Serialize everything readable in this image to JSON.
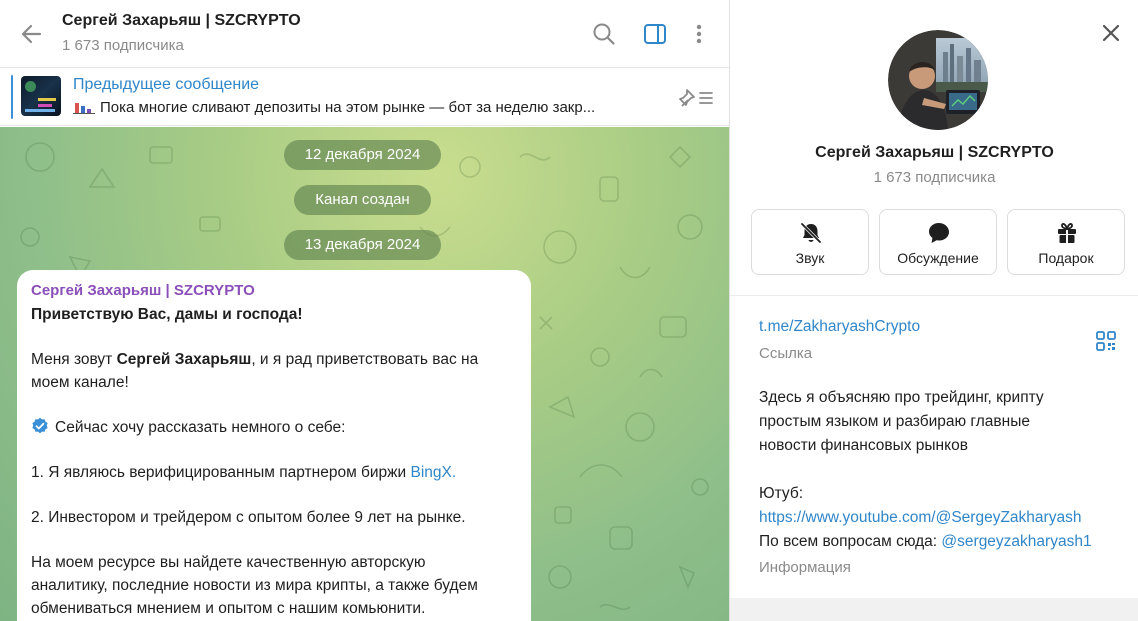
{
  "header": {
    "title": "Сергей Захарьяш | SZCRYPTO",
    "subscribers": "1 673 подписчика"
  },
  "pinned": {
    "title": "Предыдущее сообщение",
    "text": "Пока многие сливают депозиты на этом рынке — бот за неделю закр..."
  },
  "dates": [
    "12 декабря 2024",
    "Канал создан",
    "13 декабря 2024"
  ],
  "message": {
    "author": "Сергей Захарьяш | SZCRYPTO",
    "greeting": "Приветствую Вас, дамы и господа!",
    "intro_pre": "Меня зовут ",
    "intro_name": "Сергей Захарьяш",
    "intro_post": ", и я рад приветствовать вас на",
    "intro_line2": "моем канале!",
    "about": "Сейчас хочу рассказать немного о себе:",
    "point1_pre": "1. Я являюсь верифицированным партнером биржи ",
    "point1_link": "BingX.",
    "point2": "2. Инвестором и трейдером с опытом более 9 лет на рынке.",
    "resource_line1": "На моем ресурсе вы найдете качественную авторскую",
    "resource_line2": "аналитику, последние новости из мира крипты, а также будем",
    "resource_line3": "обмениваться мнением и опытом с нашим комьюнити."
  },
  "profile": {
    "name": "Сергей Захарьяш | SZCRYPTO",
    "subscribers": "1 673 подписчика",
    "actions": [
      {
        "label": "Звук",
        "icon": "bell-off-icon"
      },
      {
        "label": "Обсуждение",
        "icon": "chat-bubble-icon"
      },
      {
        "label": "Подарок",
        "icon": "gift-icon"
      }
    ],
    "link": "t.me/ZakharyashCrypto",
    "link_label": "Ссылка",
    "description_line1": "Здесь я объясняю про трейдинг, крипту",
    "description_line2": "простым языком и разбираю главные",
    "description_line3": "новости финансовых рынков",
    "youtube_label": "Ютуб:",
    "youtube_link": "https://www.youtube.com/@SergeyZakharyash",
    "contact_pre": "По всем вопросам сюда: ",
    "contact_link": "@sergeyzakharyash1",
    "info_label": "Информация"
  },
  "colors": {
    "accent": "#2f86c9",
    "author": "#8a4fb8",
    "wallpaper": "#a8cc85"
  }
}
